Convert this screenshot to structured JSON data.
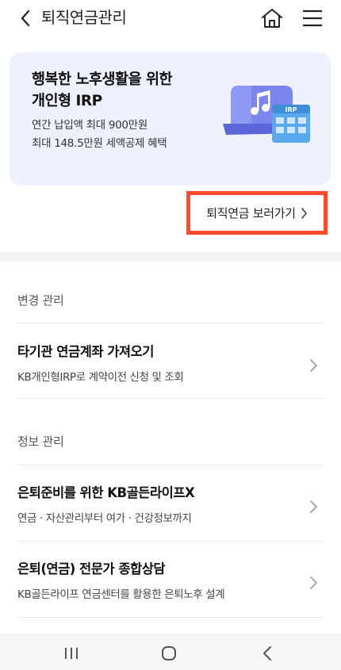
{
  "header": {
    "title": "퇴직연금관리",
    "icons": {
      "back": "chevron-left-icon",
      "home": "home-icon",
      "menu": "hamburger-menu-icon"
    }
  },
  "banner": {
    "title": "행복한 노후생활을 위한\n개인형 IRP",
    "description": "연간 납입액 최대 900만원\n최대 148.5만원 세액공제 혜택",
    "illustration_badge": "IRP",
    "colors": {
      "background": "#eef1fb",
      "accent": "#6b78ea",
      "card": "#5aa9ec"
    }
  },
  "link_button": {
    "label": "퇴직연금 보러가기",
    "highlight_color": "#ff4b2b"
  },
  "sections": [
    {
      "label": "변경 관리",
      "items": [
        {
          "title": "타기관 연금계좌 가져오기",
          "subtitle": "KB개인형IRP로 계약이전 신청 및 조회"
        }
      ]
    },
    {
      "label": "정보 관리",
      "items": [
        {
          "title": "은퇴준비를 위한 KB골든라이프X",
          "subtitle": "연금 · 자산관리부터 여가 · 건강정보까지"
        },
        {
          "title": "은퇴(연금) 전문가 종합상담",
          "subtitle": "KB골든라이프 연금센터를 활용한 은퇴노후 설계"
        }
      ]
    }
  ],
  "navbar": {
    "icons": [
      "recent-apps-icon",
      "home-circle-icon",
      "back-icon"
    ]
  }
}
